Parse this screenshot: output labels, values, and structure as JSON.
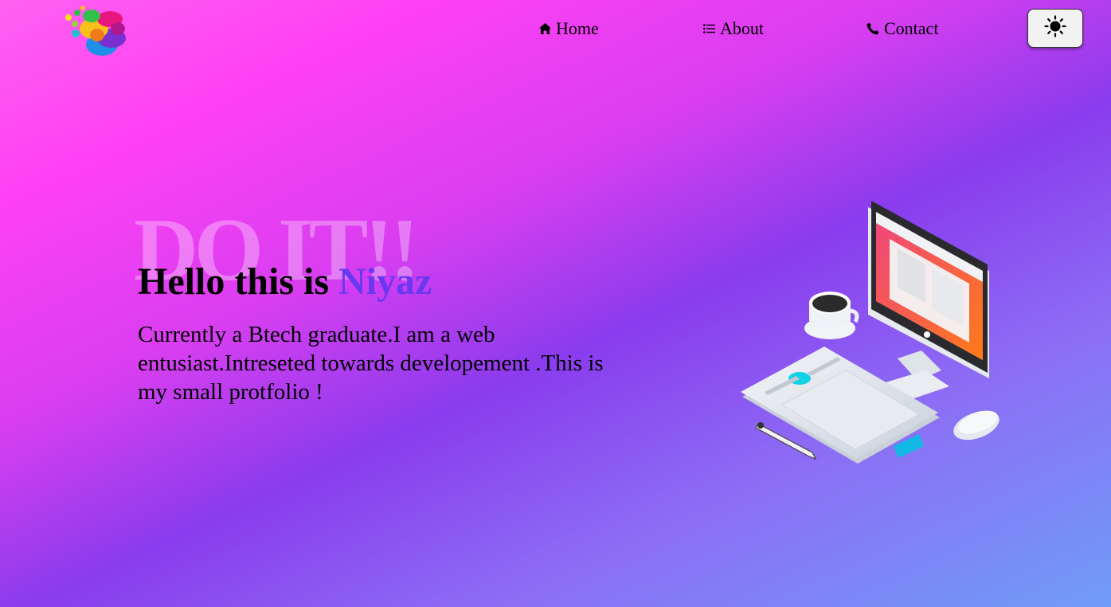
{
  "nav": {
    "home": {
      "label": "Home",
      "icon": "home-icon"
    },
    "about": {
      "label": "About",
      "icon": "list-icon"
    },
    "contact": {
      "label": "Contact",
      "icon": "phone-icon"
    }
  },
  "theme_toggle": {
    "icon": "sun-icon"
  },
  "hero": {
    "background_text": "DO IT!!",
    "title_prefix": "Hello this is ",
    "title_name": "Niyaz",
    "description": "Currently a Btech graduate.I am a web entusiast.Intreseted towards developement .This is my small protfolio !"
  },
  "colors": {
    "accent_name": "#6a38f0",
    "background_start": "#ff60f0",
    "background_end": "#6f9cf8"
  }
}
